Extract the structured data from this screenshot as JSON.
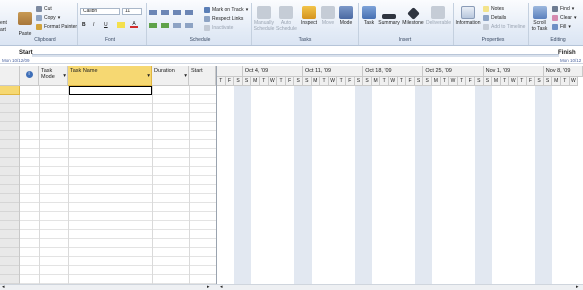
{
  "clipboard": {
    "paste": "Paste",
    "cut": "Cut",
    "copy": "Copy",
    "format_painter": "Format Painter",
    "label": "Clipboard",
    "left_cut_1": "ent",
    "left_cut_2": "art"
  },
  "font": {
    "name": "Calibri",
    "size": "11",
    "label": "Font",
    "bold": "B",
    "italic": "I",
    "underline": "U"
  },
  "schedule": {
    "mark_on_track": "Mark on Track",
    "respect_links": "Respect Links",
    "inactivate": "Inactivate",
    "label": "Schedule"
  },
  "tasks": {
    "manually": "Manually\nSchedule",
    "auto": "Auto\nSchedule",
    "inspect": "Inspect",
    "move": "Move",
    "mode": "Mode",
    "label": "Tasks"
  },
  "insert": {
    "task": "Task",
    "summary": "Summary",
    "milestone": "Milestone",
    "deliverable": "Deliverable",
    "label": "Insert"
  },
  "properties": {
    "information": "Information",
    "notes": "Notes",
    "details": "Details",
    "add_to_timeline": "Add to Timeline",
    "label": "Properties"
  },
  "editing": {
    "scroll": "Scroll\nto Task",
    "find": "Find",
    "clear": "Clear",
    "fill": "Fill",
    "label": "Editing"
  },
  "timeline": {
    "start_label": "Start",
    "start_date": "Mon 10/12/09",
    "finish_label": "Finish",
    "finish_date": "Mon 10/12"
  },
  "columns": {
    "info": "i",
    "task_mode": "Task\nMode",
    "task_name": "Task Name",
    "duration": "Duration",
    "start": "Start"
  },
  "weeks": [
    "Oct 4, '09",
    "Oct 11, '09",
    "Oct 18, '09",
    "Oct 25, '09",
    "Nov 1, '09",
    "Nov 8, '09"
  ],
  "days": [
    "T",
    "F",
    "S",
    "S",
    "M",
    "T",
    "W",
    "T",
    "F",
    "S",
    "S",
    "M",
    "T",
    "W",
    "T",
    "F",
    "S",
    "S",
    "M",
    "T",
    "W",
    "T",
    "F",
    "S",
    "S",
    "M",
    "T",
    "W",
    "T",
    "F",
    "S",
    "S",
    "M",
    "T",
    "W",
    "T",
    "F",
    "S",
    "S",
    "M",
    "T",
    "W"
  ],
  "colors": {
    "selected_header": "#f6d872",
    "active_cell": "#000000",
    "weekend_shade": "#e2e8f1"
  }
}
